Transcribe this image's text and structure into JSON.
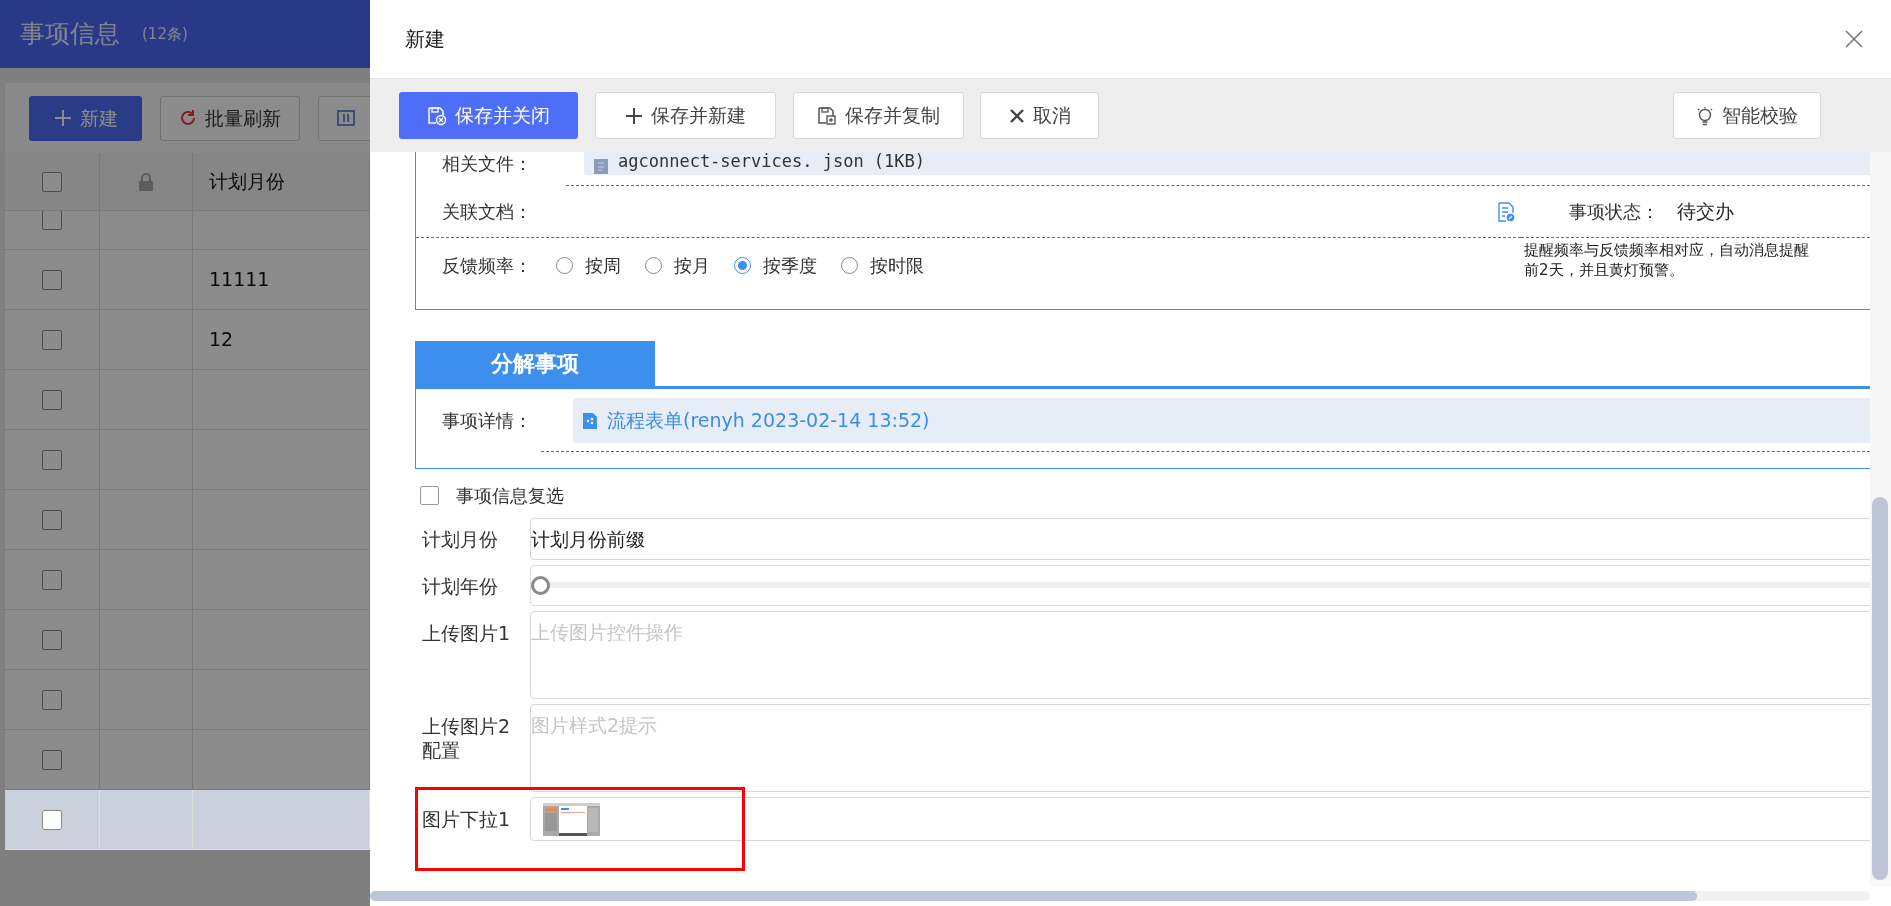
{
  "background": {
    "title": "事项信息",
    "count": "(12条)",
    "toolbar": [
      {
        "kind": "add",
        "label": "新建"
      },
      {
        "kind": "refresh",
        "label": "批量刷新"
      },
      {
        "kind": "import"
      }
    ],
    "table": {
      "columns": [
        {
          "kind": "checkbox"
        },
        {
          "kind": "lock"
        },
        {
          "kind": "text",
          "label": "计划月份"
        }
      ],
      "all_checked": false,
      "rows": [
        {
          "value": "",
          "checked": false,
          "selected": false
        },
        {
          "value": "11111",
          "checked": false,
          "selected": false
        },
        {
          "value": "12",
          "checked": false,
          "selected": false
        },
        {
          "value": "",
          "checked": false,
          "selected": false
        },
        {
          "value": "",
          "checked": false,
          "selected": false
        },
        {
          "value": "",
          "checked": false,
          "selected": false
        },
        {
          "value": "",
          "checked": false,
          "selected": false
        },
        {
          "value": "",
          "checked": false,
          "selected": false
        },
        {
          "value": "",
          "checked": false,
          "selected": false
        },
        {
          "value": "",
          "checked": false,
          "selected": false
        },
        {
          "value": "",
          "checked": false,
          "selected": true
        }
      ]
    }
  },
  "dialog": {
    "title": "新建",
    "toolbar": [
      {
        "kind": "save-close",
        "label": "保存并关闭"
      },
      {
        "kind": "add",
        "label": "保存并新建"
      },
      {
        "kind": "copy",
        "label": "保存并复制"
      },
      {
        "kind": "cancel",
        "label": "取消"
      },
      {
        "kind": "check",
        "label": "智能校验"
      }
    ],
    "related_file": {
      "label": "相关文件：",
      "value": "agconnect-services. json (1KB)"
    },
    "linked_doc": {
      "label": "关联文档：",
      "status_label": "事项状态：",
      "status_value": "待交办"
    },
    "frequency": {
      "label": "反馈频率：",
      "options": [
        {
          "label": "按周",
          "selected": false
        },
        {
          "label": "按月",
          "selected": false
        },
        {
          "label": "按季度",
          "selected": true
        },
        {
          "label": "按时限",
          "selected": false
        }
      ]
    },
    "hint_lines": [
      "提醒频率与反馈频率相对应，自动消息提醒",
      "前2天，并且黄灯预警。"
    ],
    "section": {
      "title": "分解事项",
      "detail_label": "事项详情：",
      "detail_link": "流程表单(renyh 2023-02-14 13:52)"
    },
    "checkbox": {
      "label": "事项信息复选",
      "checked": false
    },
    "form": [
      {
        "kind": "text",
        "label": "计划月份",
        "value": "计划月份前缀"
      },
      {
        "kind": "slider",
        "label": "计划年份",
        "level": 0
      },
      {
        "kind": "upload",
        "label": "上传图片1",
        "placeholder": "上传图片控件操作"
      },
      {
        "kind": "upload",
        "label": "上传图片2配置",
        "placeholder": "图片样式2提示"
      },
      {
        "label": "图片下拉1",
        "highlighted": true
      }
    ]
  }
}
